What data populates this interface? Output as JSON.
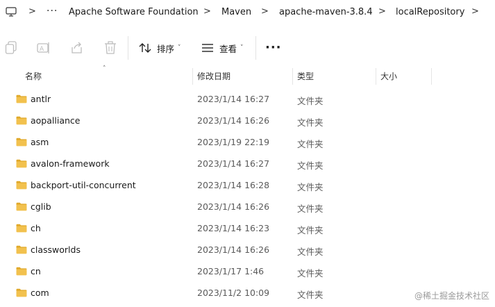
{
  "breadcrumb": {
    "more": "···",
    "items": [
      "Apache Software Foundation",
      "Maven",
      "apache-maven-3.8.4",
      "localRepository"
    ],
    "separator": ">"
  },
  "toolbar": {
    "sort_label": "排序",
    "view_label": "查看",
    "more_label": "···",
    "caret": "˅"
  },
  "columns": {
    "name": "名称",
    "date": "修改日期",
    "type": "类型",
    "size": "大小",
    "sort_indicator": "˄"
  },
  "files": [
    {
      "name": "antlr",
      "date": "2023/1/14 16:27",
      "type": "文件夹"
    },
    {
      "name": "aopalliance",
      "date": "2023/1/14 16:26",
      "type": "文件夹"
    },
    {
      "name": "asm",
      "date": "2023/1/19 22:19",
      "type": "文件夹"
    },
    {
      "name": "avalon-framework",
      "date": "2023/1/14 16:27",
      "type": "文件夹"
    },
    {
      "name": "backport-util-concurrent",
      "date": "2023/1/14 16:28",
      "type": "文件夹"
    },
    {
      "name": "cglib",
      "date": "2023/1/14 16:26",
      "type": "文件夹"
    },
    {
      "name": "ch",
      "date": "2023/1/14 16:23",
      "type": "文件夹"
    },
    {
      "name": "classworlds",
      "date": "2023/1/14 16:26",
      "type": "文件夹"
    },
    {
      "name": "cn",
      "date": "2023/1/17 1:46",
      "type": "文件夹"
    },
    {
      "name": "com",
      "date": "2023/11/2 10:09",
      "type": "文件夹"
    }
  ],
  "watermark": "@稀土掘金技术社区",
  "colors": {
    "folder": "#f2c14e",
    "folder_dark": "#e0a92b",
    "accent": "#0067c0"
  }
}
